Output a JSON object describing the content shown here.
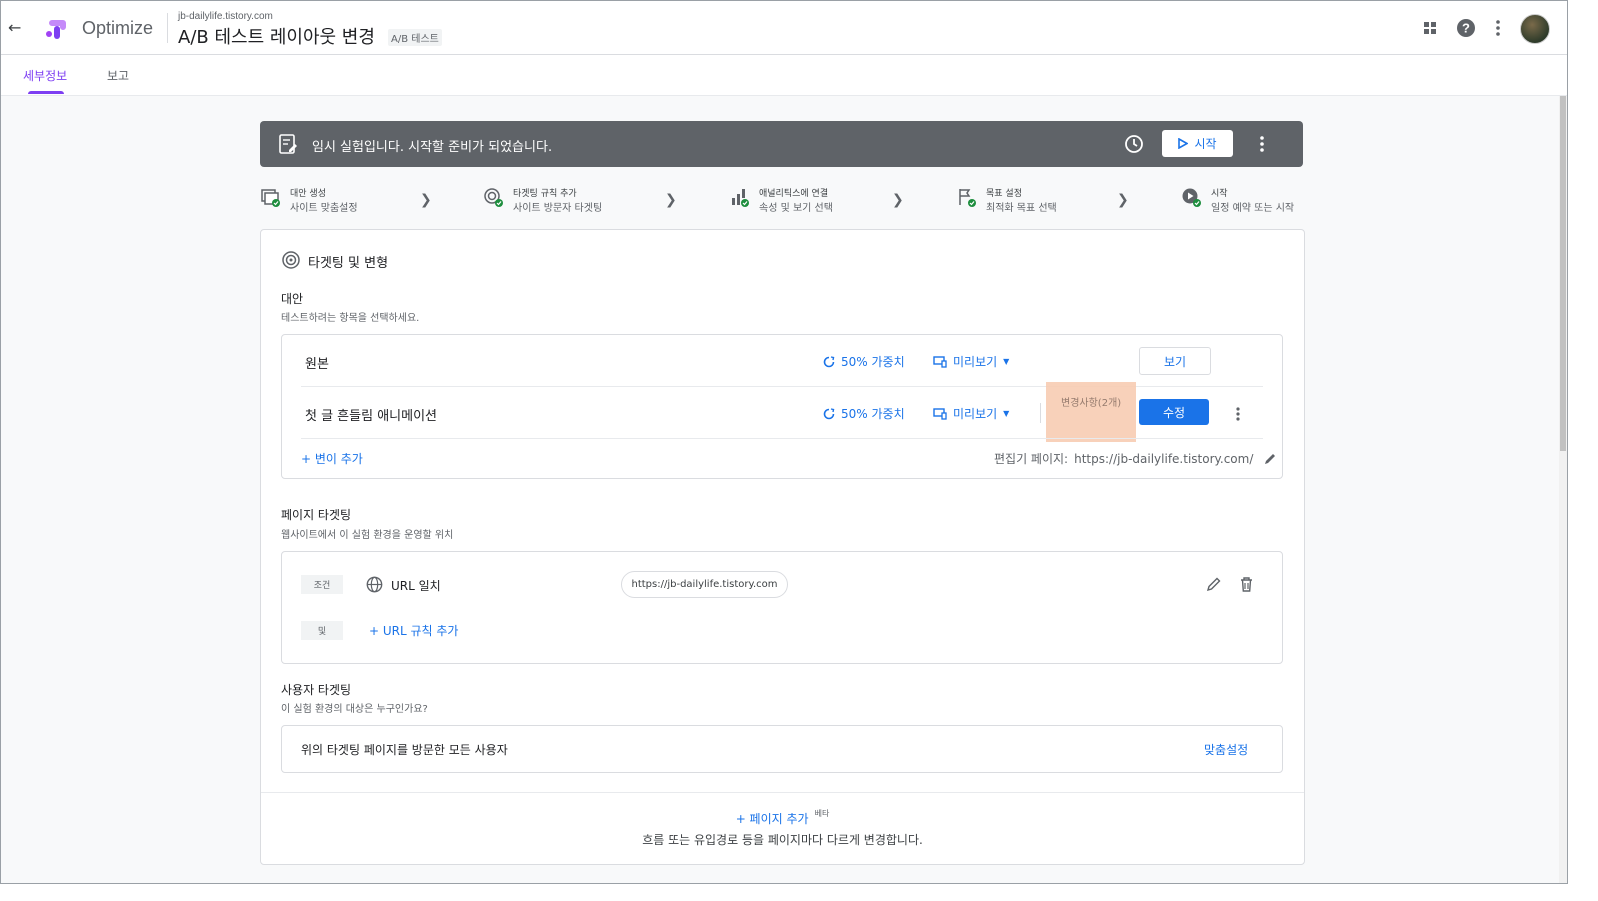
{
  "header": {
    "app_name": "Optimize",
    "domain": "jb-dailylife.tistory.com",
    "title": "A/B 테스트 레이아웃 변경",
    "type_badge": "A/B 테스트"
  },
  "tabs": [
    {
      "label": "세부정보",
      "active": true
    },
    {
      "label": "보고",
      "active": false
    }
  ],
  "banner": {
    "text": "임시 실험입니다.  시작할 준비가 되었습니다.",
    "start_label": "시작"
  },
  "steps": [
    {
      "title": "대안 생성",
      "subtitle": "사이트 맞춤설정",
      "icon": "variants-icon"
    },
    {
      "title": "타겟팅 규칙 추가",
      "subtitle": "사이트 방문자 타겟팅",
      "icon": "targeting-icon"
    },
    {
      "title": "애널리틱스에 연결",
      "subtitle": "속성 및 보기 선택",
      "icon": "analytics-icon"
    },
    {
      "title": "목표 설정",
      "subtitle": "최적화 목표 선택",
      "icon": "goal-flag-icon"
    },
    {
      "title": "시작",
      "subtitle": "일정 예약 또는 시작",
      "icon": "play-icon"
    }
  ],
  "section": {
    "title": "타겟팅 및 변형",
    "variants_label": "대안",
    "variants_hint": "테스트하려는 항목을 선택하세요.",
    "variants": [
      {
        "name": "원본",
        "weight": "50% 가중치",
        "preview": "미리보기",
        "action": "보기"
      },
      {
        "name": "첫 글 흔들림 애니메이션",
        "weight": "50% 가중치",
        "preview": "미리보기",
        "changes": "변경사항(2개)",
        "action": "수정"
      }
    ],
    "add_variant": "+ 변이 추가",
    "editor_page_label": "편집기 페이지:",
    "editor_page_url": "https://jb-dailylife.tistory.com/"
  },
  "page_targeting": {
    "label": "페이지 타겟팅",
    "hint": "웹사이트에서 이 실험 환경을 운영할 위치",
    "condition_chip": "조건",
    "rule_label": "URL 일치",
    "rule_value": "https://jb-dailylife.tistory.com",
    "and_chip": "및",
    "add_rule": "+ URL 규칙 추가"
  },
  "user_targeting": {
    "label": "사용자 타겟팅",
    "hint": "이 실험 환경의 대상은 누구인가요?",
    "rule_text": "위의 타겟팅 페이지를 방문한 모든 사용자",
    "customize": "맞춤설정"
  },
  "add_page": {
    "label": "+ 페이지 추가",
    "badge": "베타",
    "hint": "흐름 또는 유입경로 등을 페이지마다 다르게 변경합니다."
  },
  "colors": {
    "accent": "#7e3ff2",
    "link": "#1a73e8",
    "banner": "#5f6368",
    "check": "#1e8e3e",
    "highlight": "#f8cdb3"
  }
}
